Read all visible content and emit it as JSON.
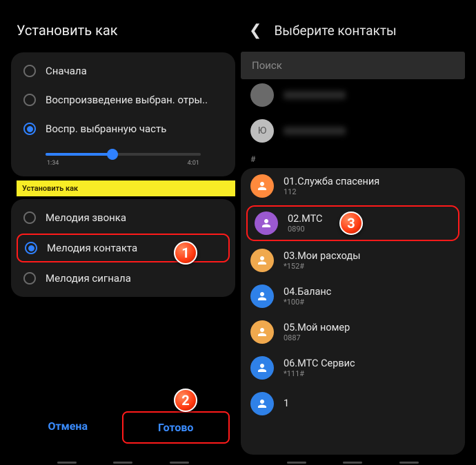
{
  "left": {
    "title": "Установить как",
    "playback": {
      "options": [
        "Сначала",
        "Воспроизведение выбран. отры..",
        "Воспр. выбранную часть"
      ],
      "selected": 2,
      "time_start": "1:34",
      "time_end": "4:01",
      "progress_pct": 43
    },
    "chip": "Установить как",
    "set_as": {
      "options": [
        "Мелодия звонка",
        "Мелодия контакта",
        "Мелодия сигнала"
      ],
      "selected": 1
    },
    "cancel": "Отмена",
    "done": "Готово"
  },
  "right": {
    "header": "Выберите контакты",
    "search_placeholder": "Поиск",
    "top_avatar_letter": "Ю",
    "section": "#",
    "contacts": [
      {
        "name": "01.Служба спасения",
        "sub": "112",
        "color": "#ff8a3d"
      },
      {
        "name": "02.МТС",
        "sub": "0890",
        "color": "#9b59d0"
      },
      {
        "name": "03.Мои расходы",
        "sub": "*152#",
        "color": "#f0a94e"
      },
      {
        "name": "04.Баланс",
        "sub": "*100#",
        "color": "#2f81e8"
      },
      {
        "name": "05.Мой номер",
        "sub": "0887",
        "color": "#f0a94e"
      },
      {
        "name": "06.МТС Сервис",
        "sub": "*111#",
        "color": "#2f81e8"
      },
      {
        "name": "1",
        "sub": "",
        "color": "#2f81e8"
      }
    ],
    "highlight_index": 1
  },
  "badges": {
    "b1": "1",
    "b2": "2",
    "b3": "3"
  }
}
